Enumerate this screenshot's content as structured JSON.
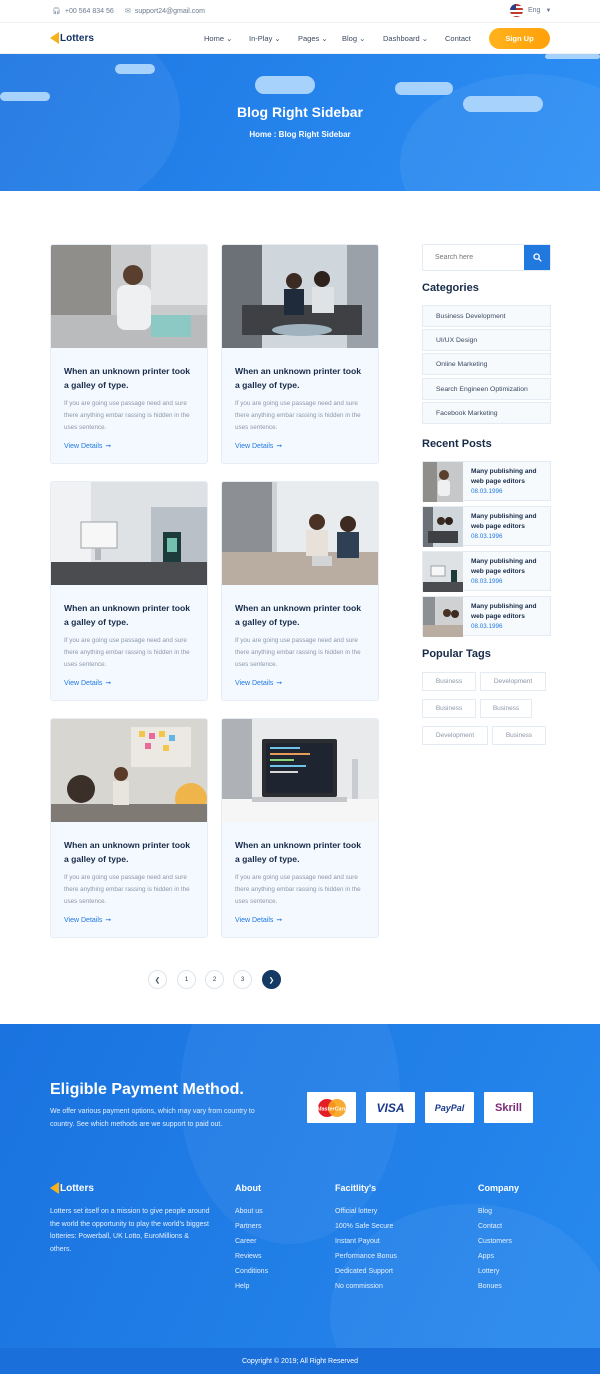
{
  "topbar": {
    "phone": "+00 564 834 56",
    "email": "support24@gmail.com",
    "language": "Eng"
  },
  "brand": {
    "name": "Lotters"
  },
  "nav": {
    "items": [
      "Home",
      "In-Play",
      "Pages",
      "Blog",
      "Dashboard",
      "Contact"
    ],
    "signup_label": "Sign Up"
  },
  "hero": {
    "title": "Blog Right Sidebar",
    "breadcrumb": "Home : Blog Right Sidebar"
  },
  "posts": [
    {
      "title": "When an unknown printer took a galley of type.",
      "excerpt": "If you are going use passage need and sure there anything embar rassing is hidden in the uses sentence.",
      "link": "View Details"
    },
    {
      "title": "When an unknown printer took a galley of type.",
      "excerpt": "If you are going use passage need and sure there anything embar rassing is hidden in the uses sentence.",
      "link": "View Details"
    },
    {
      "title": "When an unknown printer took a galley of type.",
      "excerpt": "If you are going use passage need and sure there anything embar rassing is hidden in the uses sentence.",
      "link": "View Details"
    },
    {
      "title": "When an unknown printer took a galley of type.",
      "excerpt": "If you are going use passage need and sure there anything embar rassing is hidden in the uses sentence.",
      "link": "View Details"
    },
    {
      "title": "When an unknown printer took a galley of type.",
      "excerpt": "If you are going use passage need and sure there anything embar rassing is hidden in the uses sentence.",
      "link": "View Details"
    },
    {
      "title": "When an unknown printer took a galley of type.",
      "excerpt": "If you are going use passage need and sure there anything embar rassing is hidden in the uses sentence.",
      "link": "View Details"
    }
  ],
  "pagination": {
    "pages": [
      "1",
      "2",
      "3"
    ],
    "active": "next"
  },
  "sidebar": {
    "search_placeholder": "Search here",
    "categories_title": "Categories",
    "categories": [
      "Business Development",
      "UI/UX Design",
      "Online Marketing",
      "Search Engineen Optimization",
      "Facebook Marketing"
    ],
    "recent_title": "Recent Posts",
    "recent": [
      {
        "title": "Many publishing and web page editors",
        "date": "08.03.1996"
      },
      {
        "title": "Many publishing and web page editors",
        "date": "08.03.1996"
      },
      {
        "title": "Many publishing and web page editors",
        "date": "08.03.1996"
      },
      {
        "title": "Many publishing and web page editors",
        "date": "08.03.1996"
      }
    ],
    "tags_title": "Popular Tags",
    "tags": [
      "Business",
      "Development",
      "Business",
      "Business",
      "Development",
      "Business"
    ]
  },
  "payment": {
    "title": "Eligible Payment Method.",
    "description": "We offer various payment options, which may vary from country to country. See which methods are we support to paid out.",
    "methods": [
      "MasterCard",
      "VISA",
      "PayPal",
      "Skrill"
    ]
  },
  "footer": {
    "about_text": "Lotters set itself on a mission to give people around the world the opportunity to play the world's biggest lotteries: Powerball, UK Lotto, EuroMillions & others.",
    "columns": [
      {
        "title": "About",
        "links": [
          "About us",
          "Partners",
          "Career",
          "Reviews",
          "Conditions",
          "Help"
        ]
      },
      {
        "title": "Facitlity's",
        "links": [
          "Official lottery",
          "100% Safe Secure",
          "Instant Payout",
          "Performance Bonus",
          "Dedicated Support",
          "No commission"
        ]
      },
      {
        "title": "Company",
        "links": [
          "Blog",
          "Contact",
          "Customers",
          "Apps",
          "Lottery",
          "Bonues"
        ]
      }
    ],
    "copyright": "Copyright © 2019; All Right Reserved"
  },
  "colors": {
    "primary": "#2179e0",
    "accent": "#ffb21d",
    "dark": "#143a63"
  }
}
